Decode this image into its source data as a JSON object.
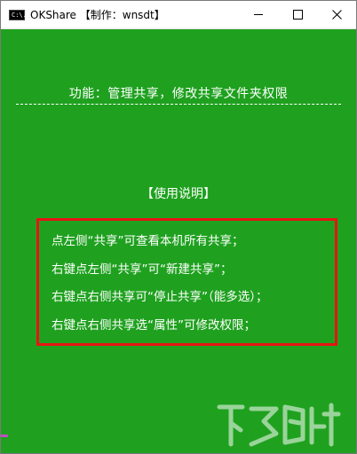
{
  "window": {
    "icon_glyph": "C:\\.",
    "icon_name": "console-icon",
    "title": "OKShare 【制作：wnsdt】",
    "controls": {
      "minimize": "minimize-icon",
      "maximize": "maximize-icon",
      "close": "close-icon"
    }
  },
  "main": {
    "function_line": "功能：管理共享，修改共享文件夹权限",
    "usage_title": "【使用说明】",
    "instructions": [
      "点左侧“共享”可查看本机所有共享；",
      "右键点左侧“共享”可“新建共享”；",
      "右键点右侧共享可“停止共享”（能多选）；",
      "右键点右侧共享选“属性”可修改权限；"
    ]
  },
  "watermark": {
    "name": "watermark-logo"
  },
  "colors": {
    "background": "#1fa11f",
    "text": "#ffffff",
    "highlight_border": "#e81313",
    "titlebar": "#ffffff"
  }
}
